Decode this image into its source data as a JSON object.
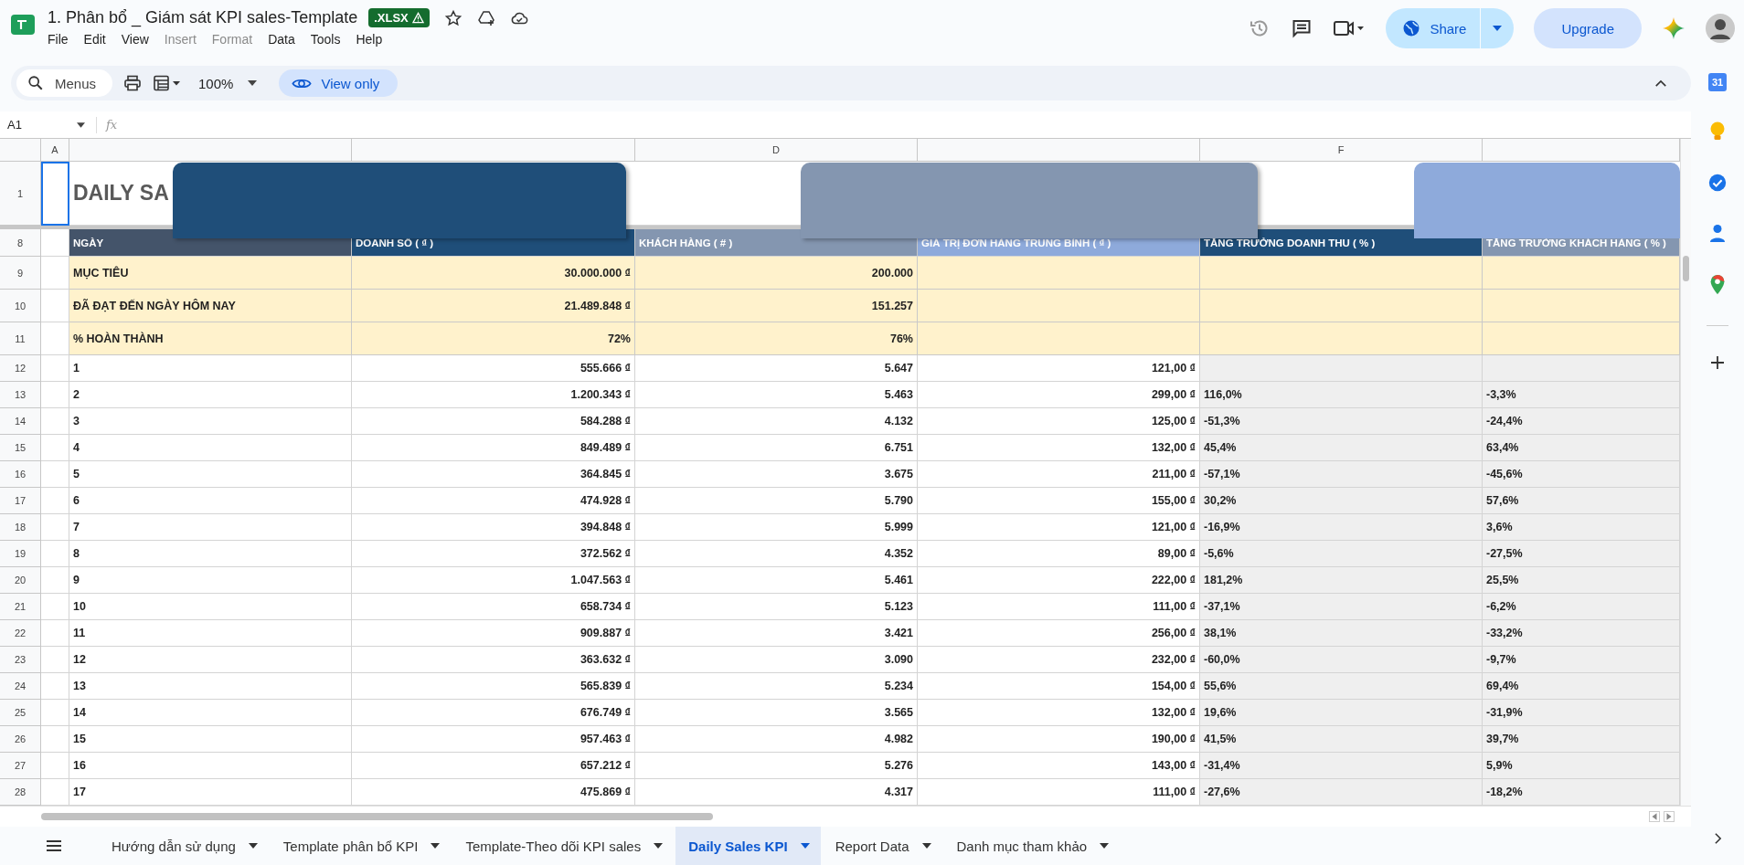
{
  "document": {
    "title": "1. Phân bổ _ Giám sát KPI sales-Template",
    "badge": ".XLSX"
  },
  "menu": [
    {
      "label": "File",
      "disabled": false
    },
    {
      "label": "Edit",
      "disabled": false
    },
    {
      "label": "View",
      "disabled": false
    },
    {
      "label": "Insert",
      "disabled": true
    },
    {
      "label": "Format",
      "disabled": true
    },
    {
      "label": "Data",
      "disabled": false
    },
    {
      "label": "Tools",
      "disabled": false
    },
    {
      "label": "Help",
      "disabled": false
    }
  ],
  "actions": {
    "share": "Share",
    "upgrade": "Upgrade"
  },
  "toolbar": {
    "search": "Menus",
    "zoom": "100%",
    "mode": "View only"
  },
  "formula_bar": {
    "cell_ref": "A1",
    "fx": "fx"
  },
  "column_letters": [
    "A",
    "D",
    "F"
  ],
  "title_row": {
    "row_number": "1",
    "text": "DAILY SA"
  },
  "header_row": {
    "row_number": "8",
    "cells": [
      {
        "text": "NGÀY",
        "color": "#44546a"
      },
      {
        "text": "DOANH SỐ  ( ₫ )",
        "color": "#1f4e79"
      },
      {
        "text": "KHÁCH HÀNG  ( # )",
        "color": "#8496b0"
      },
      {
        "text": "GIÁ TRỊ ĐƠN HÀNG TRUNG BÌNH ( ₫ )",
        "color": "#8eaadb"
      },
      {
        "text": "TĂNG TRƯỞNG DOANH THU  ( % )",
        "color": "#1f4e79"
      },
      {
        "text": "TĂNG TRƯỞNG KHÁCH HÀNG  ( % )",
        "color": "#8496b0"
      }
    ]
  },
  "summary_rows": [
    {
      "row_number": "9",
      "label": "MỤC TIÊU",
      "revenue": "30.000.000 ₫",
      "customers": "200.000"
    },
    {
      "row_number": "10",
      "label": "ĐÃ ĐẠT ĐẾN NGÀY HÔM NAY",
      "revenue": "21.489.848 ₫",
      "customers": "151.257"
    },
    {
      "row_number": "11",
      "label": "% HOÀN THÀNH",
      "revenue": "72%",
      "customers": "76%"
    }
  ],
  "data_rows": [
    {
      "row_number": "12",
      "day": "1",
      "revenue": "555.666 ₫",
      "customers": "5.647",
      "avg_order": "121,00 ₫"
    },
    {
      "row_number": "13",
      "day": "2",
      "revenue": "1.200.343 ₫",
      "customers": "5.463",
      "avg_order": "299,00 ₫",
      "revenue_growth": "116,0%",
      "customer_growth": "-3,3%"
    },
    {
      "row_number": "14",
      "day": "3",
      "revenue": "584.288 ₫",
      "customers": "4.132",
      "avg_order": "125,00 ₫",
      "revenue_growth": "-51,3%",
      "customer_growth": "-24,4%"
    },
    {
      "row_number": "15",
      "day": "4",
      "revenue": "849.489 ₫",
      "customers": "6.751",
      "avg_order": "132,00 ₫",
      "revenue_growth": "45,4%",
      "customer_growth": "63,4%"
    },
    {
      "row_number": "16",
      "day": "5",
      "revenue": "364.845 ₫",
      "customers": "3.675",
      "avg_order": "211,00 ₫",
      "revenue_growth": "-57,1%",
      "customer_growth": "-45,6%"
    },
    {
      "row_number": "17",
      "day": "6",
      "revenue": "474.928 ₫",
      "customers": "5.790",
      "avg_order": "155,00 ₫",
      "revenue_growth": "30,2%",
      "customer_growth": "57,6%"
    },
    {
      "row_number": "18",
      "day": "7",
      "revenue": "394.848 ₫",
      "customers": "5.999",
      "avg_order": "121,00 ₫",
      "revenue_growth": "-16,9%",
      "customer_growth": "3,6%"
    },
    {
      "row_number": "19",
      "day": "8",
      "revenue": "372.562 ₫",
      "customers": "4.352",
      "avg_order": "89,00 ₫",
      "revenue_growth": "-5,6%",
      "customer_growth": "-27,5%"
    },
    {
      "row_number": "20",
      "day": "9",
      "revenue": "1.047.563 ₫",
      "customers": "5.461",
      "avg_order": "222,00 ₫",
      "revenue_growth": "181,2%",
      "customer_growth": "25,5%"
    },
    {
      "row_number": "21",
      "day": "10",
      "revenue": "658.734 ₫",
      "customers": "5.123",
      "avg_order": "111,00 ₫",
      "revenue_growth": "-37,1%",
      "customer_growth": "-6,2%"
    },
    {
      "row_number": "22",
      "day": "11",
      "revenue": "909.887 ₫",
      "customers": "3.421",
      "avg_order": "256,00 ₫",
      "revenue_growth": "38,1%",
      "customer_growth": "-33,2%"
    },
    {
      "row_number": "23",
      "day": "12",
      "revenue": "363.632 ₫",
      "customers": "3.090",
      "avg_order": "232,00 ₫",
      "revenue_growth": "-60,0%",
      "customer_growth": "-9,7%"
    },
    {
      "row_number": "24",
      "day": "13",
      "revenue": "565.839 ₫",
      "customers": "5.234",
      "avg_order": "154,00 ₫",
      "revenue_growth": "55,6%",
      "customer_growth": "69,4%"
    },
    {
      "row_number": "25",
      "day": "14",
      "revenue": "676.749 ₫",
      "customers": "3.565",
      "avg_order": "132,00 ₫",
      "revenue_growth": "19,6%",
      "customer_growth": "-31,9%"
    },
    {
      "row_number": "26",
      "day": "15",
      "revenue": "957.463 ₫",
      "customers": "4.982",
      "avg_order": "190,00 ₫",
      "revenue_growth": "41,5%",
      "customer_growth": "39,7%"
    },
    {
      "row_number": "27",
      "day": "16",
      "revenue": "657.212 ₫",
      "customers": "5.276",
      "avg_order": "143,00 ₫",
      "revenue_growth": "-31,4%",
      "customer_growth": "5,9%"
    },
    {
      "row_number": "28",
      "day": "17",
      "revenue": "475.869 ₫",
      "customers": "4.317",
      "avg_order": "111,00 ₫",
      "revenue_growth": "-27,6%",
      "customer_growth": "-18,2%"
    }
  ],
  "side_panel": {
    "calendar_day": "31"
  },
  "sheet_tabs": [
    {
      "label": "Hướng dẫn sử dụng",
      "selected": false
    },
    {
      "label": "Template phân bổ KPI",
      "selected": false
    },
    {
      "label": "Template-Theo dõi KPI sales",
      "selected": false
    },
    {
      "label": "Daily Sales KPI",
      "selected": true
    },
    {
      "label": "Report Data",
      "selected": false
    },
    {
      "label": "Danh mục tham khảo",
      "selected": false
    }
  ]
}
